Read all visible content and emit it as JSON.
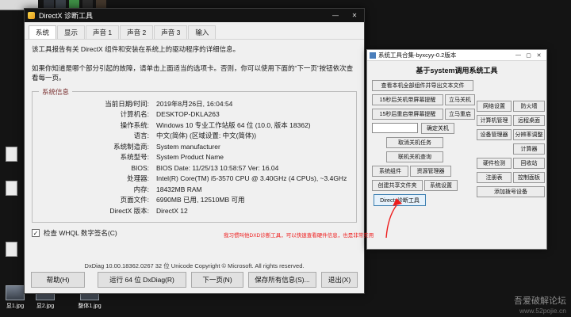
{
  "icons": {
    "minimize": "—",
    "maximize": "▢",
    "close": "✕",
    "check": "✓"
  },
  "desktop": {
    "watermark": {
      "line1": "吾爱破解论坛",
      "line2": "www.52pojie.cn"
    },
    "files": [
      {
        "label": "显1.jpg"
      },
      {
        "label": "显2.jpg"
      },
      {
        "label": "整体1.jpg"
      }
    ]
  },
  "annotation": {
    "text": "我习惯叫他DXD诊断工具，可以快速查看硬件信息，也是非常实用"
  },
  "dxdiag": {
    "title": "DirectX 诊断工具",
    "tabs": [
      "系统",
      "显示",
      "声音 1",
      "声音 2",
      "声音 3",
      "输入"
    ],
    "intro1": "该工具报告有关 DirectX 组件和安装在系统上的驱动程序的详细信息。",
    "intro2": "如果你知道是哪个部分引起的故障，请单击上面适当的选项卡。否则，你可以使用下面的“下一页”按钮依次查看每一页。",
    "group_title": "系统信息",
    "sysinfo": [
      {
        "label": "当前日期/时间:",
        "value": "2019年8月26日, 16:04:54"
      },
      {
        "label": "计算机名:",
        "value": "DESKTOP-DKLA263"
      },
      {
        "label": "操作系统:",
        "value": "Windows 10 专业工作站版 64 位 (10.0, 版本 18362)"
      },
      {
        "label": "语言:",
        "value": "中文(简体) (区域设置: 中文(简体))"
      },
      {
        "label": "系统制造商:",
        "value": "System manufacturer"
      },
      {
        "label": "系统型号:",
        "value": "System Product Name"
      },
      {
        "label": "BIOS:",
        "value": "BIOS Date: 11/25/13 10:58:57 Ver: 16.04"
      },
      {
        "label": "处理器:",
        "value": "Intel(R) Core(TM) i5-3570 CPU @ 3.40GHz (4 CPUs), ~3.4GHz"
      },
      {
        "label": "内存:",
        "value": "18432MB RAM"
      },
      {
        "label": "页面文件:",
        "value": "6990MB 已用, 12510MB 可用"
      },
      {
        "label": "DirectX 版本:",
        "value": "DirectX 12"
      }
    ],
    "whql_label": "检查 WHQL 数字签名(C)",
    "status": "DxDiag 10.00.18362.0267 32 位 Unicode  Copyright © Microsoft. All rights reserved.",
    "buttons": {
      "help": "帮助(H)",
      "run64": "运行 64 位 DxDiag(R)",
      "next": "下一页(N)",
      "save": "保存所有信息(S)...",
      "exit": "退出(X)"
    }
  },
  "tool": {
    "title": "系统工具合集-byxcyy-0.2版本",
    "header": "基于system调用系统工具",
    "btn": {
      "export": "查看本机全部组件并导出文本文件",
      "delay_shutdown": "15秒后关机带屏幕提醒",
      "now_shutdown": "立马关机",
      "delay_restart": "15秒后重启带屏幕提醒",
      "now_restart": "立马重启",
      "confirm_shutdown": "确定关机",
      "cancel_task": "取消关机任务",
      "query_task": "联机关机查询",
      "sys_components": "系统组件",
      "explorer": "资源管理器",
      "share_folder": "创建共享文件夹",
      "sys_settings": "系统设置",
      "dxdiag": "Directx诊断工具",
      "network": "网络设置",
      "firewall": "防火墙",
      "computer_mgmt": "计算机管理",
      "remote_desktop": "远程桌面",
      "device_mgr": "设备管理器",
      "resolution": "分辨率调整",
      "calculator": "计算器",
      "hardware": "硬件检测",
      "recycle": "回收站",
      "registry": "注册表",
      "control_panel": "控制面板",
      "dialup": "添加拨号设备"
    }
  }
}
